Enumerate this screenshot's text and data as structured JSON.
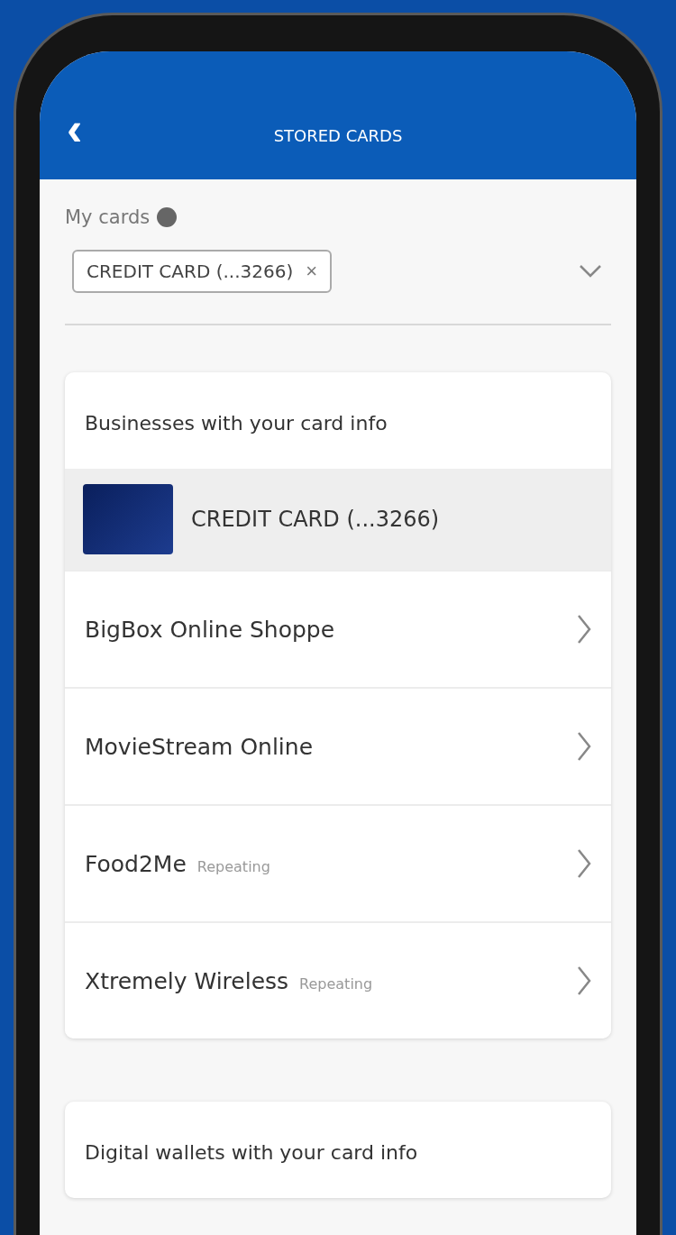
{
  "header": {
    "back": "‹",
    "title": "STORED CARDS"
  },
  "my_cards": {
    "label": "My cards",
    "selected_chip": {
      "label": "CREDIT CARD (...3266)",
      "remove": "×"
    }
  },
  "businesses": {
    "title": "Businesses with your card info",
    "card": {
      "label": "CREDIT CARD (...3266)"
    },
    "rows": [
      {
        "name": "BigBox Online Shoppe"
      },
      {
        "name": "MovieStream Online"
      },
      {
        "name": "Food2Me",
        "tag": "Repeating"
      },
      {
        "name": "Xtremely Wireless",
        "tag": "Repeating"
      }
    ]
  },
  "wallets": {
    "title": "Digital wallets with your card info"
  }
}
